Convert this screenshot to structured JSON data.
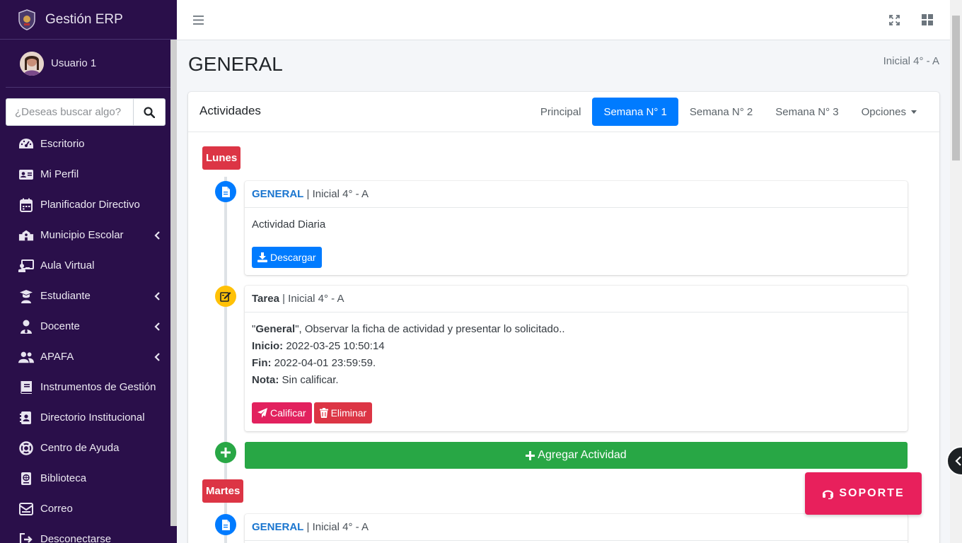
{
  "sidebar": {
    "brand": "Gestión ERP",
    "user": "Usuario 1",
    "search_placeholder": "¿Deseas buscar algo?",
    "items": [
      {
        "label": "Escritorio",
        "icon": "dashboard-icon",
        "chevron": false
      },
      {
        "label": "Mi Perfil",
        "icon": "id-card-icon",
        "chevron": false
      },
      {
        "label": "Planificador Directivo",
        "icon": "calendar-icon",
        "chevron": false
      },
      {
        "label": "Municipio Escolar",
        "icon": "school-icon",
        "chevron": true
      },
      {
        "label": "Aula Virtual",
        "icon": "chalkboard-teacher-icon",
        "chevron": false
      },
      {
        "label": "Estudiante",
        "icon": "graduate-icon",
        "chevron": true
      },
      {
        "label": "Docente",
        "icon": "user-tie-icon",
        "chevron": true
      },
      {
        "label": "APAFA",
        "icon": "users-icon",
        "chevron": true
      },
      {
        "label": "Instrumentos de Gestión",
        "icon": "book-icon",
        "chevron": false
      },
      {
        "label": "Directorio Institucional",
        "icon": "address-book-icon",
        "chevron": false
      },
      {
        "label": "Centro de Ayuda",
        "icon": "life-ring-icon",
        "chevron": false
      },
      {
        "label": "Biblioteca",
        "icon": "book-reader-icon",
        "chevron": false
      },
      {
        "label": "Correo",
        "icon": "mail-bulk-icon",
        "chevron": false
      },
      {
        "label": "Desconectarse",
        "icon": "sign-out-icon",
        "chevron": false
      }
    ]
  },
  "header": {
    "title": "GENERAL",
    "breadcrumb": "Inicial 4° - A"
  },
  "card": {
    "title": "Actividades",
    "tabs": [
      "Principal",
      "Semana N° 1",
      "Semana N° 2",
      "Semana N° 3"
    ],
    "options_label": "Opciones"
  },
  "timeline": {
    "monday": "Lunes",
    "tuesday": "Martes",
    "item1": {
      "course": "GENERAL",
      "sep": " | ",
      "section": "Inicial 4° - A",
      "body": "Actividad Diaria",
      "button": "Descargar"
    },
    "item2": {
      "type": "Tarea",
      "sep": " | ",
      "section": "Inicial 4° - A",
      "quote_open": "\"",
      "course": "General",
      "desc": "\", Observar la ficha de actividad y presentar lo solicitado..",
      "start_label": "Inicio:",
      "start_value": " 2022-03-25 10:50:14",
      "end_label": "Fin:",
      "end_value": " 2022-04-01 23:59:59.",
      "grade_label": "Nota:",
      "grade_value": " Sin calificar.",
      "grade_button": "Calificar",
      "delete_button": "Eliminar"
    },
    "add_button": "Agregar Actividad",
    "item3": {
      "course": "GENERAL",
      "sep": " | ",
      "section": "Inicial 4° - A"
    }
  },
  "support_button": "SOPORTE",
  "colors": {
    "sidebar_bg": "#2a0f4a",
    "primary": "#007bff",
    "danger": "#dc3545",
    "success": "#28a745",
    "support": "#e8205c",
    "warning": "#ffc107"
  }
}
